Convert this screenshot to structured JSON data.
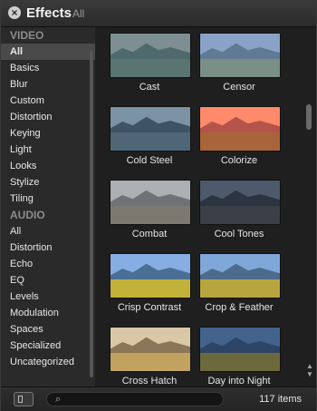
{
  "window": {
    "title": "Effects",
    "subtitle": "All"
  },
  "sidebar": {
    "video_header": "VIDEO",
    "video_items": [
      "All",
      "Basics",
      "Blur",
      "Custom",
      "Distortion",
      "Keying",
      "Light",
      "Looks",
      "Stylize",
      "Tiling"
    ],
    "selected": "All",
    "audio_header": "AUDIO",
    "audio_items": [
      "All",
      "Distortion",
      "Echo",
      "EQ",
      "Levels",
      "Modulation",
      "Spaces",
      "Specialized",
      "Uncategorized"
    ]
  },
  "effects": [
    {
      "label": "Cast",
      "sky": "#7d8f92",
      "mtn": "#4f6a6d",
      "ground": "#5a7472"
    },
    {
      "label": "Censor",
      "sky": "#8aa2c8",
      "mtn": "#5f7a93",
      "ground": "#7a8f86"
    },
    {
      "label": "Cold Steel",
      "sky": "#7c93a6",
      "mtn": "#3e5366",
      "ground": "#4f6677"
    },
    {
      "label": "Colorize",
      "sky": "#ff8a6b",
      "mtn": "#b5544a",
      "ground": "#a8653b"
    },
    {
      "label": "Combat",
      "sky": "#aab0b4",
      "mtn": "#6f7276",
      "ground": "#7c7a70"
    },
    {
      "label": "Cool Tones",
      "sky": "#4d5a6c",
      "mtn": "#2c3442",
      "ground": "#3a3f48"
    },
    {
      "label": "Crisp Contrast",
      "sky": "#86aee3",
      "mtn": "#4a6e94",
      "ground": "#c2b23a"
    },
    {
      "label": "Crop & Feather",
      "sky": "#7fa7d8",
      "mtn": "#4d6b8c",
      "ground": "#b6a63d"
    },
    {
      "label": "Cross Hatch",
      "sky": "#d9c7a6",
      "mtn": "#8a7658",
      "ground": "#c1a35f"
    },
    {
      "label": "Day into Night",
      "sky": "#42648c",
      "mtn": "#2c4566",
      "ground": "#6c6a3d"
    }
  ],
  "footer": {
    "search_placeholder": "",
    "item_count": "117 items"
  }
}
